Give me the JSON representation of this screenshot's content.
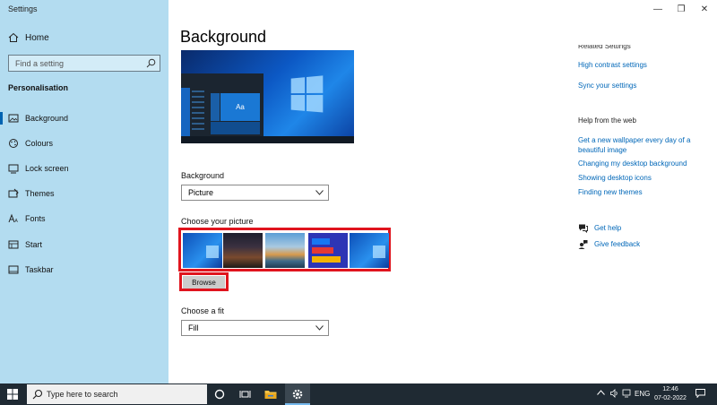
{
  "window": {
    "title": "Settings",
    "controls": {
      "minimize": "—",
      "maximize": "❐",
      "close": "✕"
    }
  },
  "sidebar": {
    "home_label": "Home",
    "search_placeholder": "Find a setting",
    "section_title": "Personalisation",
    "items": [
      {
        "label": "Background",
        "icon": "picture-icon",
        "active": true
      },
      {
        "label": "Colours",
        "icon": "palette-icon"
      },
      {
        "label": "Lock screen",
        "icon": "lock-screen-icon"
      },
      {
        "label": "Themes",
        "icon": "themes-icon"
      },
      {
        "label": "Fonts",
        "icon": "fonts-icon"
      },
      {
        "label": "Start",
        "icon": "start-icon"
      },
      {
        "label": "Taskbar",
        "icon": "taskbar-icon"
      }
    ]
  },
  "main": {
    "title": "Background",
    "preview": {
      "tile_label": "Aa"
    },
    "background_label": "Background",
    "background_value": "Picture",
    "choose_picture_label": "Choose your picture",
    "thumbnails": [
      "windows-blue",
      "night-sky",
      "sunset-lake",
      "social-media-buttons",
      "windows-blue"
    ],
    "browse_label": "Browse",
    "fit_label": "Choose a fit",
    "fit_value": "Fill"
  },
  "right": {
    "related_heading": "Related Settings",
    "related_links": [
      "High contrast settings",
      "Sync your settings"
    ],
    "help_heading": "Help from the web",
    "help_links": [
      "Get a new wallpaper every day of a",
      "beautiful image",
      "Changing my desktop background",
      "Showing desktop icons",
      "Finding new themes"
    ],
    "get_help": "Get help",
    "give_feedback": "Give feedback"
  },
  "taskbar": {
    "search_placeholder": "Type here to search",
    "tray_language": "ENG",
    "time": "12:46",
    "date": "07-02-2022"
  },
  "colors": {
    "sidebar_bg": "#b3dcf0",
    "accent": "#0063b1",
    "link": "#0067b8",
    "highlight": "#e0141e",
    "taskbar": "#1f2a33"
  }
}
